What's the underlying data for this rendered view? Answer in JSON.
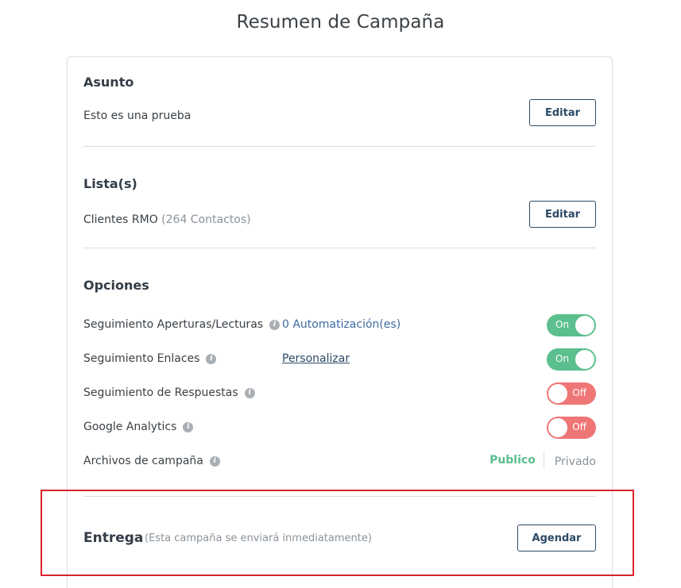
{
  "title": "Resumen de Campaña",
  "subject": {
    "heading": "Asunto",
    "value": "Esto es una prueba",
    "edit_label": "Editar"
  },
  "lists": {
    "heading": "Lista(s)",
    "name": "Clientes RMO",
    "count": "(264 Contactos)",
    "edit_label": "Editar"
  },
  "options": {
    "heading": "Opciones",
    "rows": [
      {
        "label": "Seguimiento Aperturas/Lecturas",
        "extra": "0 Automatización(es)",
        "state": "On"
      },
      {
        "label": "Seguimiento Enlaces",
        "extra": "Personalizar",
        "state": "On"
      },
      {
        "label": "Seguimiento de Respuestas",
        "state": "Off"
      },
      {
        "label": "Google Analytics",
        "state": "Off"
      }
    ],
    "archive": {
      "label": "Archivos de campaña",
      "public_label": "Publico",
      "private_label": "Privado",
      "selected": "Publico"
    }
  },
  "delivery": {
    "heading": "Entrega",
    "note": "(Esta campaña se enviará inmediatamente)",
    "schedule_label": "Agendar"
  },
  "colors": {
    "toggle_on": "#5bbf8e",
    "toggle_off": "#ef7676",
    "button_border": "#2c4a66",
    "highlight": "#d9232d"
  }
}
